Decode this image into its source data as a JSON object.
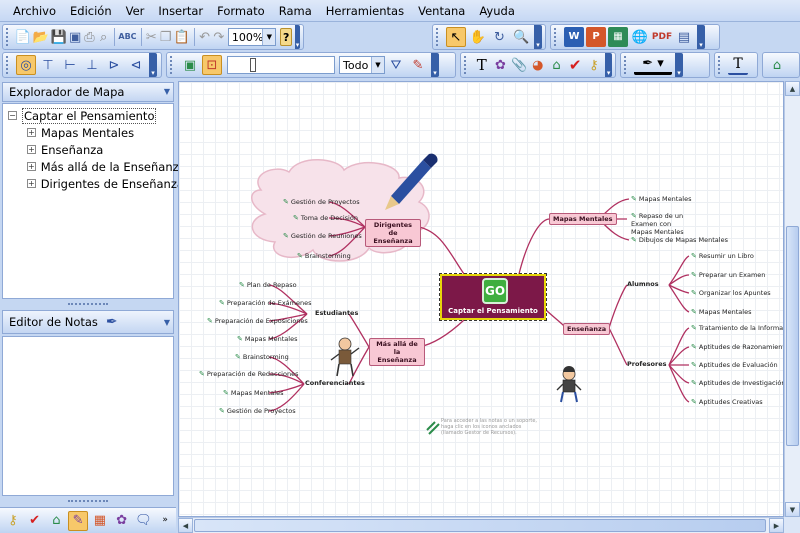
{
  "menu": [
    "Archivo",
    "Edición",
    "Ver",
    "Insertar",
    "Formato",
    "Rama",
    "Herramientas",
    "Ventana",
    "Ayuda"
  ],
  "toolbar": {
    "zoom": "100%",
    "filter": "Todo"
  },
  "map_explorer": {
    "title": "Explorador de Mapa",
    "root": "Captar el Pensamiento",
    "children": [
      "Mapas Mentales",
      "Enseñanza",
      "Más allá de la Enseñanza",
      "Dirigentes de Enseñanza"
    ]
  },
  "notes_editor": {
    "title": "Editor de Notas"
  },
  "map": {
    "central": {
      "go": "GO",
      "label": "Captar el Pensamiento"
    },
    "topics": {
      "mapas_mentales": "Mapas Mentales",
      "dirigentes": "Dirigentes de Enseñanza",
      "ensenanza": "Enseñanza",
      "alumnos": "Alumnos",
      "profesores": "Profesores",
      "mas_alla": "Más allá de la Enseñanza",
      "estudiantes": "Estudiantes",
      "conferenciantes": "Conferenciantes"
    },
    "mapas_mentales_items": [
      "Mapas Mentales",
      "Repaso de un Examen con Mapas Mentales",
      "Dibujos de Mapas Mentales"
    ],
    "dirigentes_items": [
      "Gestión de Proyectos",
      "Toma de Decisión",
      "Gestión de Reuniones",
      "Brainstorming"
    ],
    "alumnos_items": [
      "Resumir un Libro",
      "Preparar un Examen",
      "Organizar los Apuntes",
      "Mapas Mentales"
    ],
    "profesores_items": [
      "Tratamiento de la Información",
      "Aptitudes de Razonamiento",
      "Aptitudes de Evaluación",
      "Aptitudes de Investigación",
      "Aptitudes Creativas"
    ],
    "estudiantes_items": [
      "Plan de Repaso",
      "Preparación de Exámenes",
      "Preparación de Exposiciones",
      "Mapas Mentales"
    ],
    "conferenciantes_items": [
      "Brainstorming",
      "Preparación de Redacciones",
      "Mapas Mentales",
      "Gestión de Proyectos"
    ],
    "hint": [
      "Para acceder a las notas o un soporte,",
      "haga clic en los iconos anclados",
      "(llamado Gestor de Recursos)."
    ]
  },
  "colors": {
    "topic_fill": "#f8c8d4",
    "branch": "#b03060",
    "central_fill": "#7c1848",
    "central_border": "#e8d60a"
  }
}
